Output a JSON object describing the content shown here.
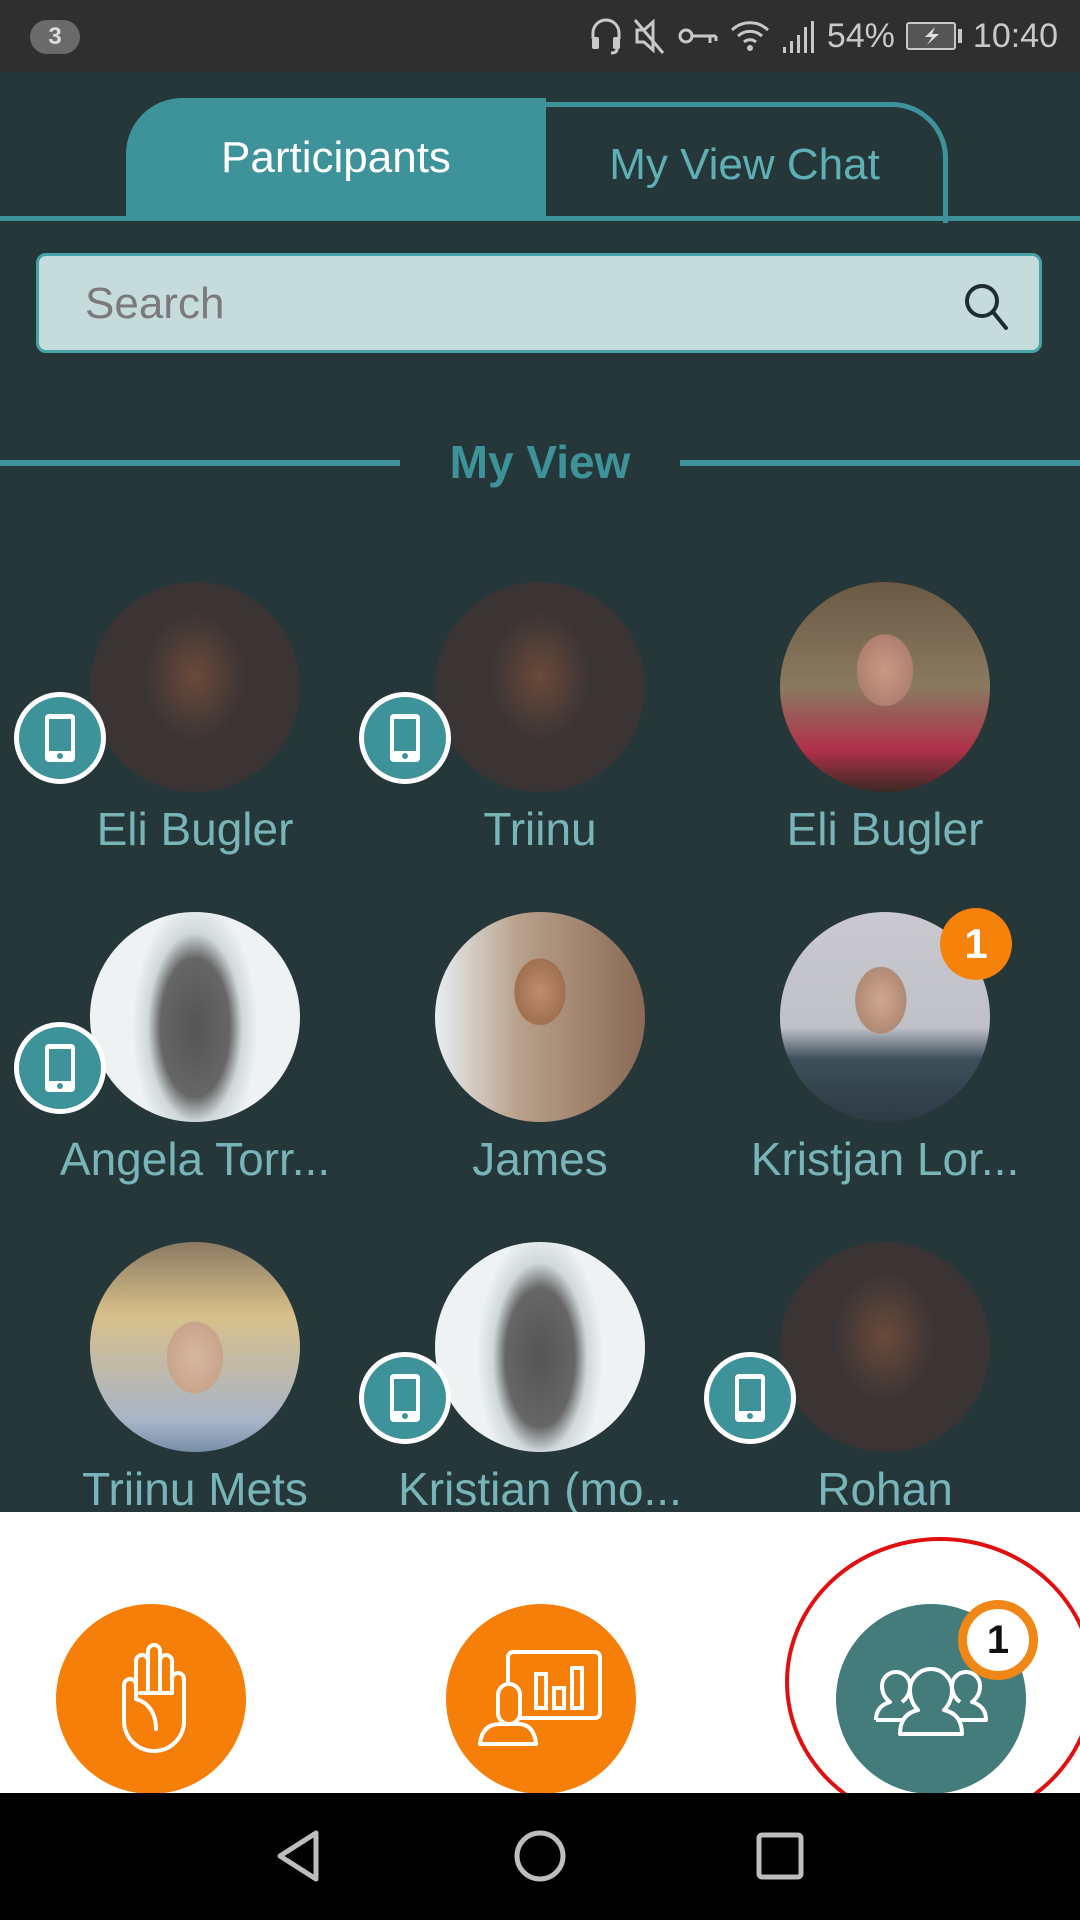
{
  "status_bar": {
    "notification_count": "3",
    "icons": [
      "headset-icon",
      "mute-icon",
      "vpn-key-icon",
      "wifi-icon",
      "signal-icon",
      "battery-charging-icon"
    ],
    "battery": "54%",
    "time": "10:40"
  },
  "tabs": [
    {
      "label": "Participants",
      "active": true
    },
    {
      "label": "My View Chat",
      "active": false
    }
  ],
  "search": {
    "placeholder": "Search",
    "value": ""
  },
  "section": {
    "title": "My View"
  },
  "participants": [
    {
      "name": "Eli Bugler",
      "mobile": true,
      "badge": null,
      "avatar": "blurred-dark"
    },
    {
      "name": "Triinu",
      "mobile": true,
      "badge": null,
      "avatar": "blurred-dark"
    },
    {
      "name": "Eli Bugler",
      "mobile": false,
      "badge": null,
      "avatar": "photo-woman-glasses"
    },
    {
      "name": "Angela Torr...",
      "mobile": true,
      "badge": null,
      "avatar": "blurred-light"
    },
    {
      "name": "James",
      "mobile": false,
      "badge": null,
      "avatar": "photo-man-beard"
    },
    {
      "name": "Kristjan Lor...",
      "mobile": false,
      "badge": "1",
      "avatar": "photo-man-hoodie"
    },
    {
      "name": "Triinu Mets",
      "mobile": false,
      "badge": null,
      "avatar": "photo-woman-blonde"
    },
    {
      "name": "Kristian (mo...",
      "mobile": true,
      "badge": null,
      "avatar": "blurred-light"
    },
    {
      "name": "Rohan",
      "mobile": true,
      "badge": null,
      "avatar": "blurred-dark"
    }
  ],
  "bottom_actions": {
    "raise_hand": {
      "icon": "raise-hand-icon"
    },
    "presentation": {
      "icon": "presenter-icon"
    },
    "participants": {
      "icon": "participants-icon",
      "badge": "1"
    }
  },
  "colors": {
    "accent_teal": "#3d9399",
    "background": "#26373a",
    "orange": "#f57f08",
    "highlight_red": "#e01010"
  },
  "nav": {
    "back": "back-icon",
    "home": "home-icon",
    "recents": "recents-icon"
  }
}
